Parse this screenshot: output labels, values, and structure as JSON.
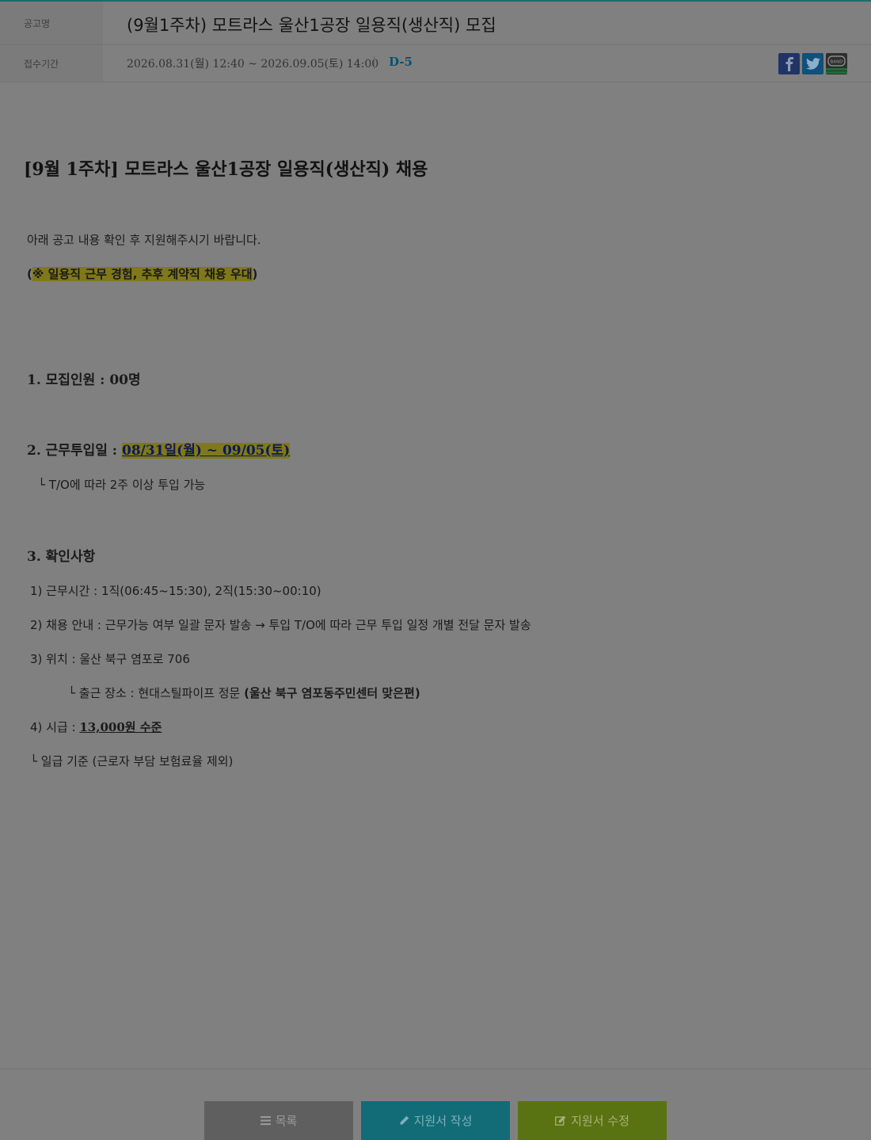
{
  "header": {
    "title_label": "공고명",
    "title": "(9월1주차) 모트라스 울산1공장 일용직(생산직) 모집",
    "period_label": "접수기간",
    "period": "2026.08.31(월) 12:40 ~ 2026.09.05(토) 14:00",
    "dday": "D-5",
    "share_band_label": "BAND"
  },
  "post": {
    "title": "[9월 1주차] 모트라스 울산1공장 일용직(생산직) 채용",
    "intro": "아래 공고 내용 확인 후 지원해주시기 바랍니다.",
    "notice_open": "(",
    "notice": "※ 일용직 근무 경험, 추후 계약직 채용 우대",
    "notice_close": ")",
    "s1_heading": "1. 모집인원 : 00명",
    "s2_heading_prefix": "2. 근무투입일 : ",
    "s2_dates": "08/31일(월) ~ 09/05(토)",
    "s2_note": "└ T/O에 따라 2주 이상 투입 가능",
    "s3_heading": "3. 확인사항",
    "s3_item1": "1) 근무시간 : 1직(06:45~15:30), 2직(15:30~00:10)",
    "s3_item2": "2) 채용 안내 : 근무가능 여부 일괄 문자 발송  →  투입 T/O에 따라 근무 투입 일정 개별 전달 문자 발송",
    "s3_item3": "3) 위치 : 울산 북구 염포로 706",
    "s3_item3_sub_prefix": "└ 출근 장소 : 현대스틸파이프 정문 ",
    "s3_item3_sub_bold": "(울산 북구 염포동주민센터 맞은편)",
    "s3_item4_prefix": "4) 시급 : ",
    "s3_item4_value": "13,000원 수준",
    "s3_item4_note": "└ 일급 기준 (근로자 부담 보험료율 제외)"
  },
  "buttons": {
    "list": "목록",
    "write": "지원서 작성",
    "edit": "지원서 수정"
  },
  "colors": {
    "overlay": "#808080",
    "accent_dday": "#0c4f70",
    "highlight": "#80791a",
    "btn_list": "#5f5f5f",
    "btn_write": "#116c78",
    "btn_edit": "#5a7312"
  }
}
